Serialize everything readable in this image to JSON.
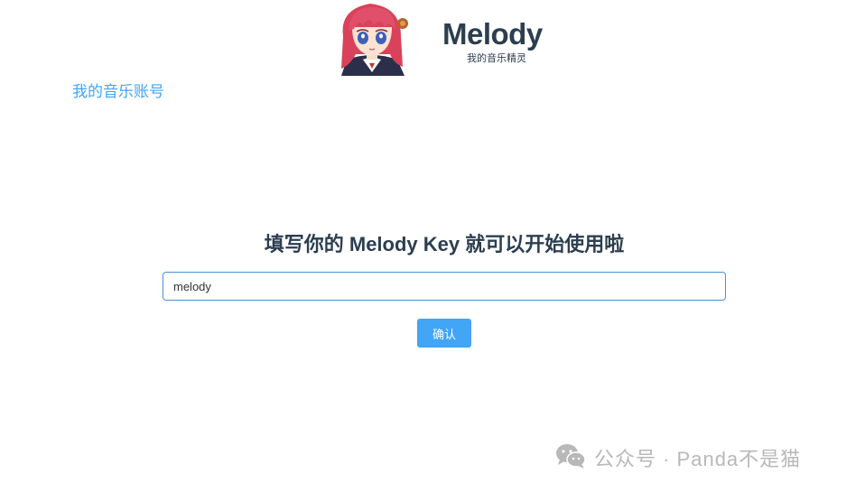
{
  "header": {
    "brand_name": "Melody",
    "brand_sub": "我的音乐精灵",
    "avatar_icon": "anime-girl-avatar-icon"
  },
  "nav": {
    "account_link": "我的音乐账号"
  },
  "main": {
    "title": "填写你的 Melody Key 就可以开始使用啦",
    "key_input_value": "melody",
    "confirm_label": "确认"
  },
  "watermark": {
    "icon": "wechat-icon",
    "text": "公众号 · Panda不是猫"
  },
  "colors": {
    "accent": "#42a5f5",
    "text": "#2c3e50",
    "watermark": "#b8b8b8"
  }
}
